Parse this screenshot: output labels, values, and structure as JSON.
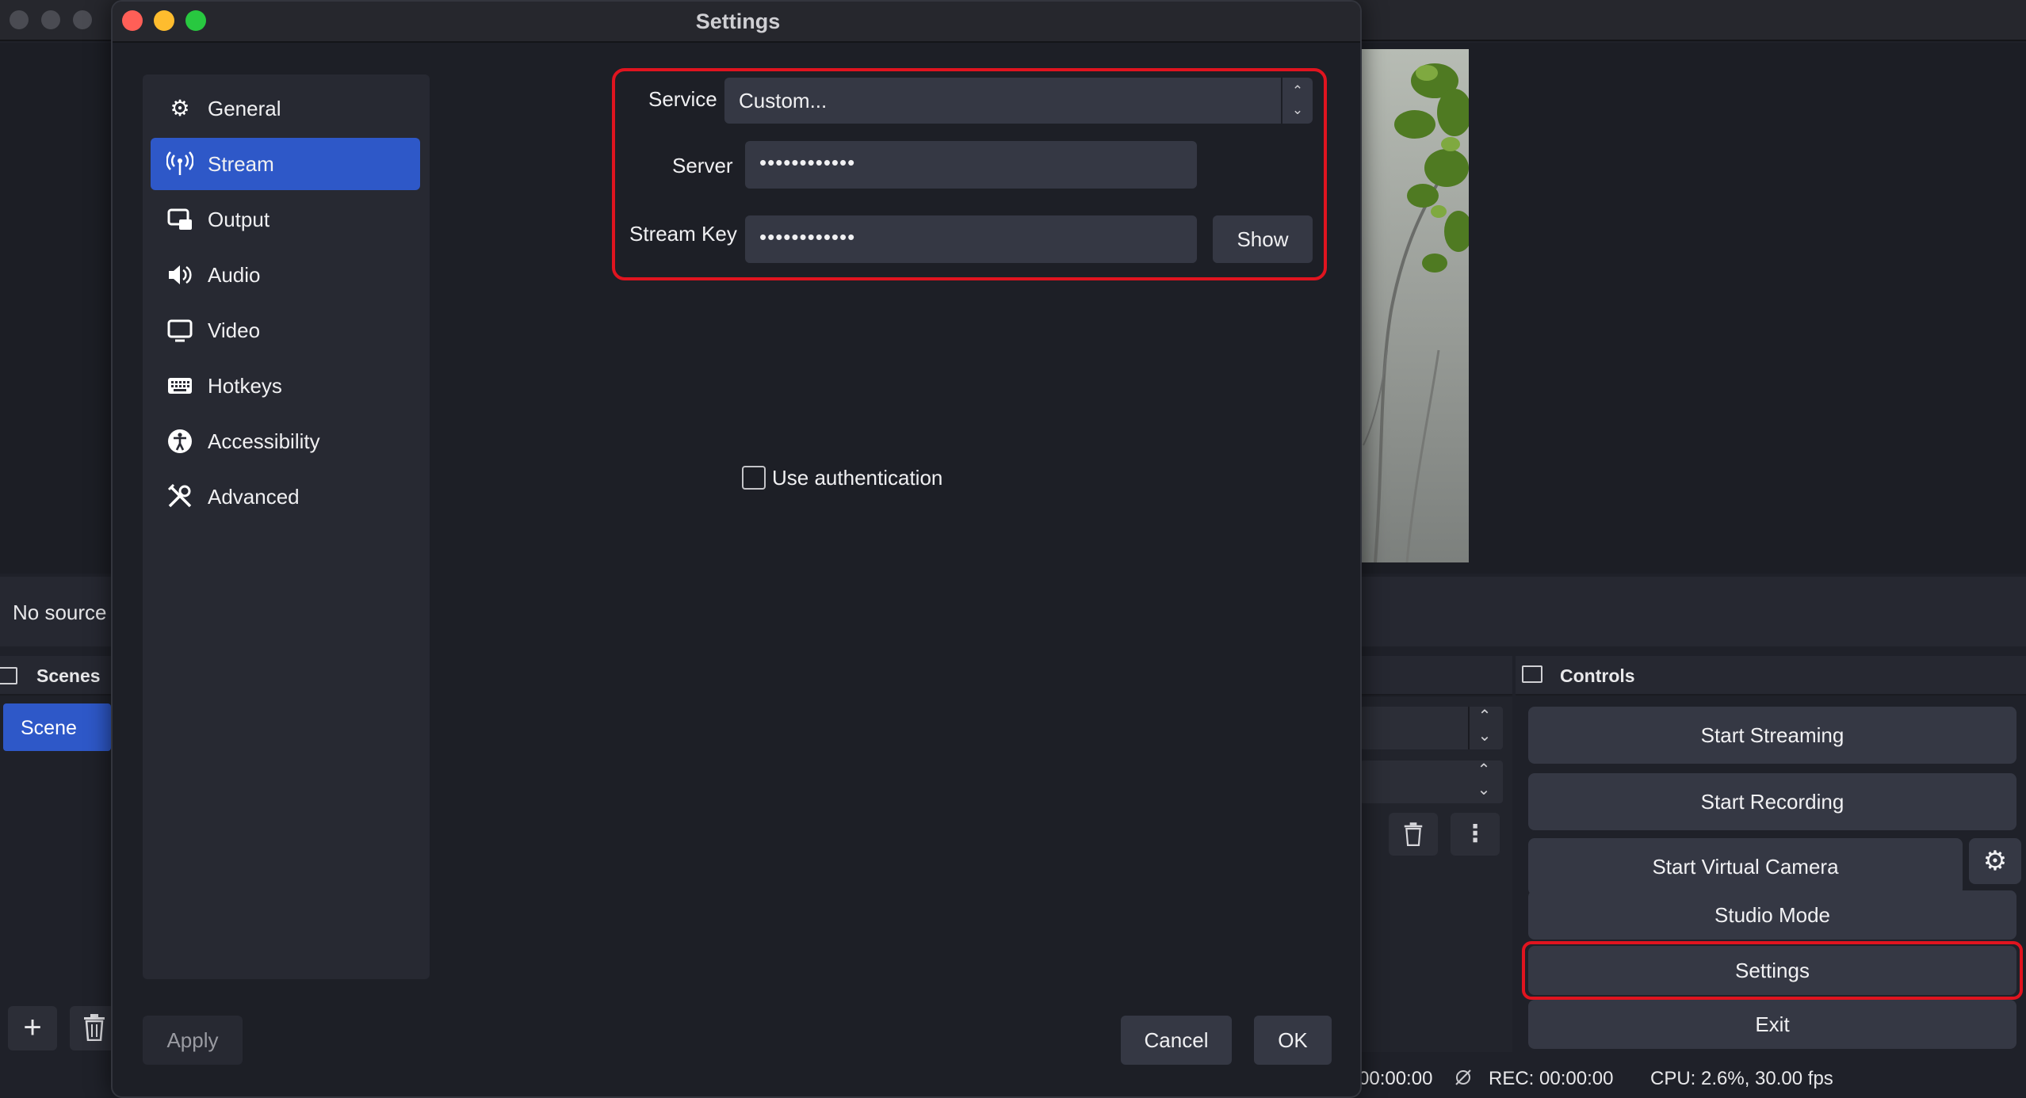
{
  "settings_dialog": {
    "title": "Settings",
    "sidebar": {
      "items": [
        {
          "label": "General",
          "icon": "gear-icon"
        },
        {
          "label": "Stream",
          "icon": "antenna-icon",
          "active": true
        },
        {
          "label": "Output",
          "icon": "output-icon"
        },
        {
          "label": "Audio",
          "icon": "speaker-icon"
        },
        {
          "label": "Video",
          "icon": "monitor-icon"
        },
        {
          "label": "Hotkeys",
          "icon": "keyboard-icon"
        },
        {
          "label": "Accessibility",
          "icon": "accessibility-icon"
        },
        {
          "label": "Advanced",
          "icon": "tools-icon"
        }
      ]
    },
    "stream": {
      "service_label": "Service",
      "service_value": "Custom...",
      "server_label": "Server",
      "server_value": "••••••••••••",
      "stream_key_label": "Stream Key",
      "stream_key_value": "••••••••••••",
      "show_button": "Show",
      "use_auth_label": "Use authentication",
      "use_auth_checked": false
    },
    "buttons": {
      "apply": "Apply",
      "cancel": "Cancel",
      "ok": "OK"
    }
  },
  "main_window": {
    "sources": {
      "empty_text": "No source"
    },
    "scenes": {
      "title": "Scenes",
      "items": [
        "Scene"
      ]
    },
    "controls": {
      "title": "Controls",
      "start_streaming": "Start Streaming",
      "start_recording": "Start Recording",
      "start_virtual_camera": "Start Virtual Camera",
      "studio_mode": "Studio Mode",
      "settings": "Settings",
      "exit": "Exit"
    },
    "status": {
      "stream_time": "00:00:00",
      "rec_time": "REC: 00:00:00",
      "cpu": "CPU: 2.6%, 30.00 fps"
    }
  },
  "colors": {
    "accent": "#2e58c8",
    "highlight": "#e0141f",
    "panel": "#272932",
    "button": "#353844"
  }
}
